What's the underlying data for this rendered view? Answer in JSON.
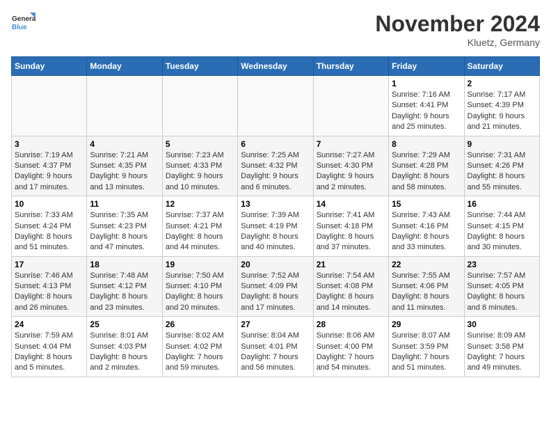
{
  "logo": {
    "line1": "General",
    "line2": "Blue"
  },
  "title": "November 2024",
  "location": "Kluetz, Germany",
  "weekdays": [
    "Sunday",
    "Monday",
    "Tuesday",
    "Wednesday",
    "Thursday",
    "Friday",
    "Saturday"
  ],
  "weeks": [
    [
      {
        "day": "",
        "info": ""
      },
      {
        "day": "",
        "info": ""
      },
      {
        "day": "",
        "info": ""
      },
      {
        "day": "",
        "info": ""
      },
      {
        "day": "",
        "info": ""
      },
      {
        "day": "1",
        "info": "Sunrise: 7:16 AM\nSunset: 4:41 PM\nDaylight: 9 hours and 25 minutes."
      },
      {
        "day": "2",
        "info": "Sunrise: 7:17 AM\nSunset: 4:39 PM\nDaylight: 9 hours and 21 minutes."
      }
    ],
    [
      {
        "day": "3",
        "info": "Sunrise: 7:19 AM\nSunset: 4:37 PM\nDaylight: 9 hours and 17 minutes."
      },
      {
        "day": "4",
        "info": "Sunrise: 7:21 AM\nSunset: 4:35 PM\nDaylight: 9 hours and 13 minutes."
      },
      {
        "day": "5",
        "info": "Sunrise: 7:23 AM\nSunset: 4:33 PM\nDaylight: 9 hours and 10 minutes."
      },
      {
        "day": "6",
        "info": "Sunrise: 7:25 AM\nSunset: 4:32 PM\nDaylight: 9 hours and 6 minutes."
      },
      {
        "day": "7",
        "info": "Sunrise: 7:27 AM\nSunset: 4:30 PM\nDaylight: 9 hours and 2 minutes."
      },
      {
        "day": "8",
        "info": "Sunrise: 7:29 AM\nSunset: 4:28 PM\nDaylight: 8 hours and 58 minutes."
      },
      {
        "day": "9",
        "info": "Sunrise: 7:31 AM\nSunset: 4:26 PM\nDaylight: 8 hours and 55 minutes."
      }
    ],
    [
      {
        "day": "10",
        "info": "Sunrise: 7:33 AM\nSunset: 4:24 PM\nDaylight: 8 hours and 51 minutes."
      },
      {
        "day": "11",
        "info": "Sunrise: 7:35 AM\nSunset: 4:23 PM\nDaylight: 8 hours and 47 minutes."
      },
      {
        "day": "12",
        "info": "Sunrise: 7:37 AM\nSunset: 4:21 PM\nDaylight: 8 hours and 44 minutes."
      },
      {
        "day": "13",
        "info": "Sunrise: 7:39 AM\nSunset: 4:19 PM\nDaylight: 8 hours and 40 minutes."
      },
      {
        "day": "14",
        "info": "Sunrise: 7:41 AM\nSunset: 4:18 PM\nDaylight: 8 hours and 37 minutes."
      },
      {
        "day": "15",
        "info": "Sunrise: 7:43 AM\nSunset: 4:16 PM\nDaylight: 8 hours and 33 minutes."
      },
      {
        "day": "16",
        "info": "Sunrise: 7:44 AM\nSunset: 4:15 PM\nDaylight: 8 hours and 30 minutes."
      }
    ],
    [
      {
        "day": "17",
        "info": "Sunrise: 7:46 AM\nSunset: 4:13 PM\nDaylight: 8 hours and 26 minutes."
      },
      {
        "day": "18",
        "info": "Sunrise: 7:48 AM\nSunset: 4:12 PM\nDaylight: 8 hours and 23 minutes."
      },
      {
        "day": "19",
        "info": "Sunrise: 7:50 AM\nSunset: 4:10 PM\nDaylight: 8 hours and 20 minutes."
      },
      {
        "day": "20",
        "info": "Sunrise: 7:52 AM\nSunset: 4:09 PM\nDaylight: 8 hours and 17 minutes."
      },
      {
        "day": "21",
        "info": "Sunrise: 7:54 AM\nSunset: 4:08 PM\nDaylight: 8 hours and 14 minutes."
      },
      {
        "day": "22",
        "info": "Sunrise: 7:55 AM\nSunset: 4:06 PM\nDaylight: 8 hours and 11 minutes."
      },
      {
        "day": "23",
        "info": "Sunrise: 7:57 AM\nSunset: 4:05 PM\nDaylight: 8 hours and 8 minutes."
      }
    ],
    [
      {
        "day": "24",
        "info": "Sunrise: 7:59 AM\nSunset: 4:04 PM\nDaylight: 8 hours and 5 minutes."
      },
      {
        "day": "25",
        "info": "Sunrise: 8:01 AM\nSunset: 4:03 PM\nDaylight: 8 hours and 2 minutes."
      },
      {
        "day": "26",
        "info": "Sunrise: 8:02 AM\nSunset: 4:02 PM\nDaylight: 7 hours and 59 minutes."
      },
      {
        "day": "27",
        "info": "Sunrise: 8:04 AM\nSunset: 4:01 PM\nDaylight: 7 hours and 56 minutes."
      },
      {
        "day": "28",
        "info": "Sunrise: 8:06 AM\nSunset: 4:00 PM\nDaylight: 7 hours and 54 minutes."
      },
      {
        "day": "29",
        "info": "Sunrise: 8:07 AM\nSunset: 3:59 PM\nDaylight: 7 hours and 51 minutes."
      },
      {
        "day": "30",
        "info": "Sunrise: 8:09 AM\nSunset: 3:58 PM\nDaylight: 7 hours and 49 minutes."
      }
    ]
  ]
}
